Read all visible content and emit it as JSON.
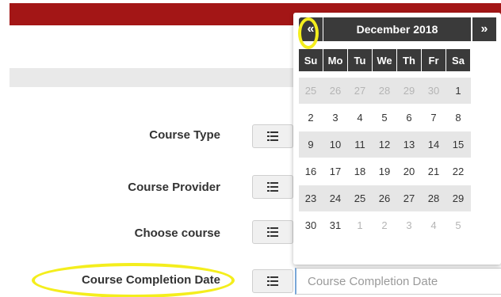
{
  "form": {
    "rows": [
      {
        "label": "Course Type"
      },
      {
        "label": "Course Provider"
      },
      {
        "label": "Choose course"
      },
      {
        "label": "Course Completion Date"
      }
    ],
    "completion_date_input": {
      "value": "",
      "placeholder": "Course Completion Date"
    }
  },
  "datepicker": {
    "prev_label": "«",
    "title": "December 2018",
    "next_label": "»",
    "weekdays": [
      "Su",
      "Mo",
      "Tu",
      "We",
      "Th",
      "Fr",
      "Sa"
    ],
    "weeks": [
      [
        {
          "d": "25",
          "other": true
        },
        {
          "d": "26",
          "other": true
        },
        {
          "d": "27",
          "other": true
        },
        {
          "d": "28",
          "other": true
        },
        {
          "d": "29",
          "other": true
        },
        {
          "d": "30",
          "other": true
        },
        {
          "d": "1",
          "other": false
        }
      ],
      [
        {
          "d": "2",
          "other": false
        },
        {
          "d": "3",
          "other": false
        },
        {
          "d": "4",
          "other": false
        },
        {
          "d": "5",
          "other": false
        },
        {
          "d": "6",
          "other": false
        },
        {
          "d": "7",
          "other": false
        },
        {
          "d": "8",
          "other": false
        }
      ],
      [
        {
          "d": "9",
          "other": false
        },
        {
          "d": "10",
          "other": false
        },
        {
          "d": "11",
          "other": false
        },
        {
          "d": "12",
          "other": false
        },
        {
          "d": "13",
          "other": false
        },
        {
          "d": "14",
          "other": false
        },
        {
          "d": "15",
          "other": false
        }
      ],
      [
        {
          "d": "16",
          "other": false
        },
        {
          "d": "17",
          "other": false
        },
        {
          "d": "18",
          "other": false
        },
        {
          "d": "19",
          "other": false
        },
        {
          "d": "20",
          "other": false
        },
        {
          "d": "21",
          "other": false
        },
        {
          "d": "22",
          "other": false
        }
      ],
      [
        {
          "d": "23",
          "other": false
        },
        {
          "d": "24",
          "other": false
        },
        {
          "d": "25",
          "other": false
        },
        {
          "d": "26",
          "other": false
        },
        {
          "d": "27",
          "other": false
        },
        {
          "d": "28",
          "other": false
        },
        {
          "d": "29",
          "other": false
        }
      ],
      [
        {
          "d": "30",
          "other": false
        },
        {
          "d": "31",
          "other": false
        },
        {
          "d": "1",
          "other": true
        },
        {
          "d": "2",
          "other": true
        },
        {
          "d": "3",
          "other": true
        },
        {
          "d": "4",
          "other": true
        },
        {
          "d": "5",
          "other": true
        }
      ]
    ]
  },
  "icons": {
    "list_button": "list-icon"
  },
  "colors": {
    "header_bar": "#a31616",
    "highlight": "#f4ee1d",
    "picker_dark": "#3a3a3a"
  }
}
